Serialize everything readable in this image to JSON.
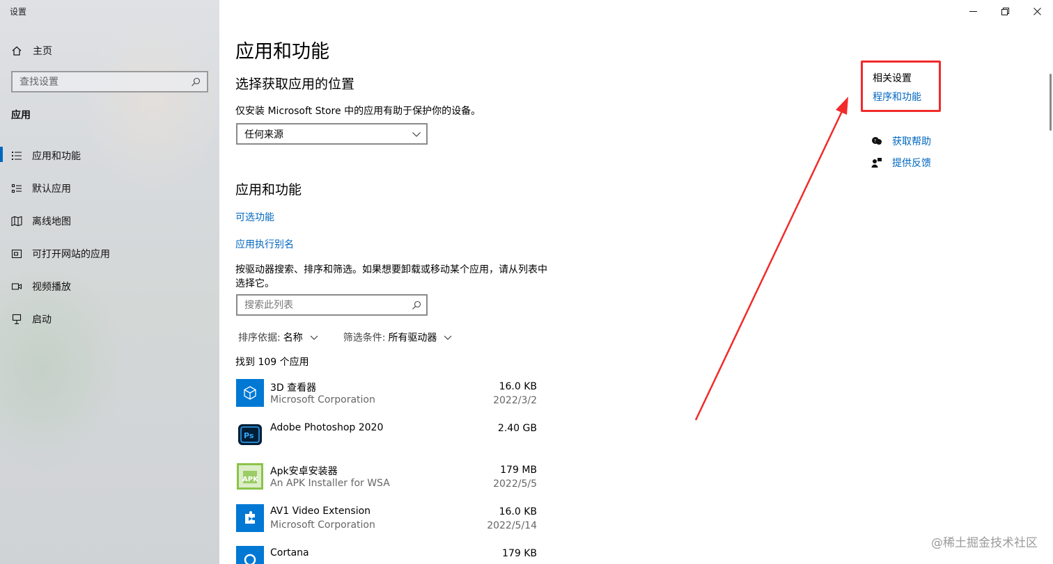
{
  "window": {
    "title": "设置",
    "controls": [
      "minimize-icon",
      "restore-icon",
      "close-icon"
    ]
  },
  "sidebar": {
    "home_label": "主页",
    "search_placeholder": "查找设置",
    "section": "应用",
    "items": [
      {
        "label": "应用和功能",
        "icon": "apps-features-icon",
        "active": true
      },
      {
        "label": "默认应用",
        "icon": "default-apps-icon",
        "active": false
      },
      {
        "label": "离线地图",
        "icon": "offline-maps-icon",
        "active": false
      },
      {
        "label": "可打开网站的应用",
        "icon": "apps-for-websites-icon",
        "active": false
      },
      {
        "label": "视频播放",
        "icon": "video-playback-icon",
        "active": false
      },
      {
        "label": "启动",
        "icon": "startup-icon",
        "active": false
      }
    ]
  },
  "main": {
    "page_title": "应用和功能",
    "source_section": {
      "heading": "选择获取应用的位置",
      "description": "仅安装 Microsoft Store 中的应用有助于保护你的设备。",
      "dropdown_value": "任何来源"
    },
    "apps_section": {
      "heading": "应用和功能",
      "optional_features_link": "可选功能",
      "app_alias_link": "应用执行别名",
      "description": "按驱动器搜索、排序和筛选。如果想要卸载或移动某个应用，请从列表中选择它。",
      "search_placeholder": "搜索此列表",
      "sort_key": "排序依据:",
      "sort_value": "名称",
      "filter_key": "筛选条件:",
      "filter_value": "所有驱动器",
      "count_text": "找到 109 个应用"
    },
    "apps": [
      {
        "name": "3D 查看器",
        "publisher": "Microsoft Corporation",
        "size": "16.0 KB",
        "date": "2022/3/2",
        "icon": "3d-viewer-icon",
        "color": "#0078d4"
      },
      {
        "name": "Adobe Photoshop 2020",
        "publisher": "",
        "size": "2.40 GB",
        "date": "",
        "icon": "photoshop-icon",
        "color": "#001e36"
      },
      {
        "name": "Apk安卓安装器",
        "publisher": "An APK Installer for WSA",
        "size": "179 MB",
        "date": "2022/5/5",
        "icon": "apk-installer-icon",
        "color": "#8bc34a"
      },
      {
        "name": "AV1 Video Extension",
        "publisher": "Microsoft Corporation",
        "size": "16.0 KB",
        "date": "2022/5/14",
        "icon": "av1-extension-icon",
        "color": "#0078d4"
      },
      {
        "name": "Cortana",
        "publisher": "",
        "size": "179 KB",
        "date": "",
        "icon": "cortana-icon",
        "color": "#0078d4"
      }
    ]
  },
  "related": {
    "title": "相关设置",
    "programs_link": "程序和功能",
    "get_help": "获取帮助",
    "give_feedback": "提供反馈",
    "highlight_color": "#f22a2a"
  },
  "watermark": "@稀土掘金技术社区"
}
